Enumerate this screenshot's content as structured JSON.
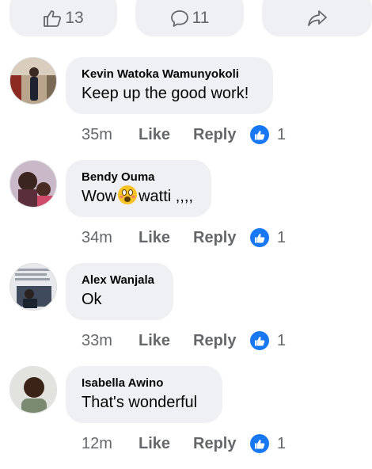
{
  "actions": {
    "like_count": "13",
    "comment_count": "11"
  },
  "comments": [
    {
      "author": "Kevin Watoka Wamunyokoli",
      "text": "Keep up the good work!",
      "time": "35m",
      "like_label": "Like",
      "reply_label": "Reply",
      "reactions": "1"
    },
    {
      "author": "Bendy Ouma",
      "text_before": "Wow",
      "text_after": "watti ,,,,",
      "time": "34m",
      "like_label": "Like",
      "reply_label": "Reply",
      "reactions": "1"
    },
    {
      "author": "Alex Wanjala",
      "text": "Ok",
      "time": "33m",
      "like_label": "Like",
      "reply_label": "Reply",
      "reactions": "1"
    },
    {
      "author": "Isabella Awino",
      "text": "That's wonderful",
      "time": "12m",
      "like_label": "Like",
      "reply_label": "Reply",
      "reactions": "1"
    }
  ],
  "colors": {
    "accent": "#1877f2",
    "bubble": "#eef0f3",
    "meta": "#65676b"
  },
  "icons": [
    "thumbs-up-outline-icon",
    "comment-outline-icon",
    "share-arrow-icon",
    "like-reaction-icon",
    "wow-emoji-icon"
  ]
}
